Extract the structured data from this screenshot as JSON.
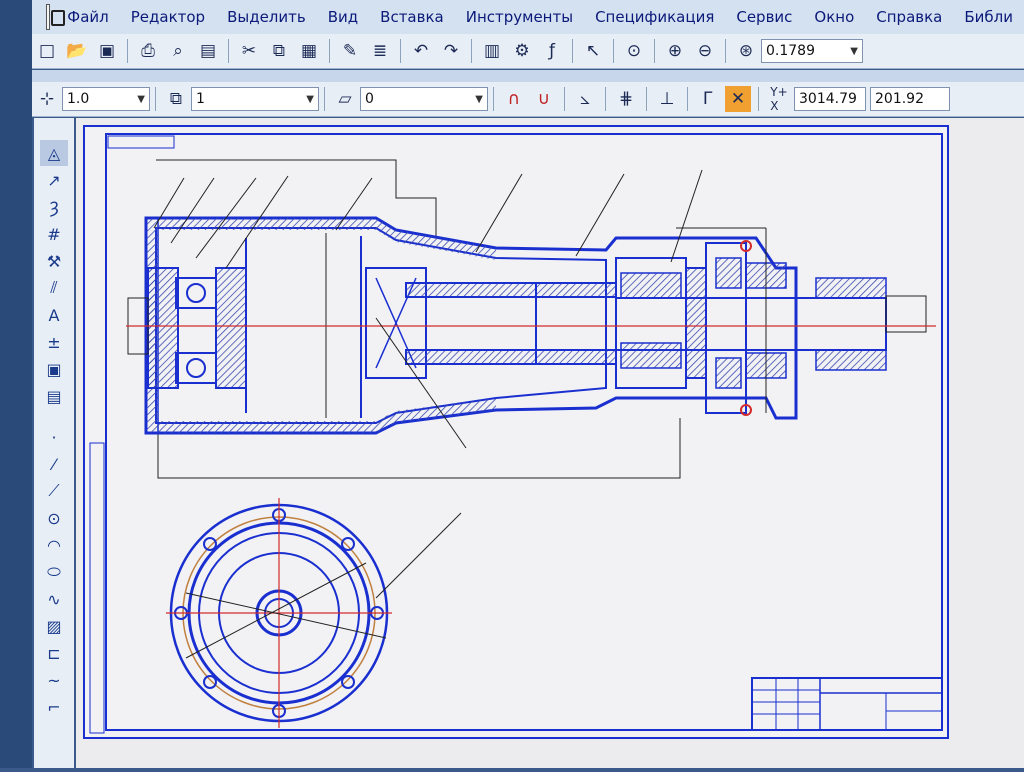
{
  "menu": [
    "Файл",
    "Редактор",
    "Выделить",
    "Вид",
    "Вставка",
    "Инструменты",
    "Спецификация",
    "Сервис",
    "Окно",
    "Справка",
    "Библи"
  ],
  "toolbar1": {
    "zoom_value": "0.1789"
  },
  "toolbar2": {
    "line_scale": "1.0",
    "layer_value": "1",
    "style_value": "0",
    "coord_x": "3014.79",
    "coord_y": "201.92"
  },
  "icons": {
    "file_row": [
      "new-icon",
      "open-icon",
      "save-icon",
      "print-icon",
      "preview-icon",
      "properties-icon",
      "cut-icon",
      "copy-icon",
      "paste-icon",
      "format-painter-icon",
      "list-icon",
      "undo-icon",
      "redo-icon",
      "manager-icon",
      "library-icon",
      "variables-icon",
      "help-pointer-icon",
      "zoom-window-icon",
      "zoom-in-icon",
      "zoom-out-icon",
      "zoom-scale-icon"
    ],
    "left_tools": [
      "geometry-icon",
      "dimensions-icon",
      "notation-icon",
      "edit-icon",
      "parametrize-icon",
      "measure-icon",
      "select-icon",
      "spec-icon",
      "report-icon",
      "insert-icon",
      "point-icon",
      "line-icon",
      "segment-icon",
      "circle-icon",
      "arc-icon",
      "ellipse-icon",
      "spline-icon",
      "hatch-icon",
      "contour-icon",
      "curve-icon",
      "corner-icon"
    ]
  },
  "colors": {
    "drawing_blue": "#1a2fd0",
    "axis_red": "#d32b2b",
    "hatch": "#5a6bb0",
    "background": "#ececef"
  }
}
